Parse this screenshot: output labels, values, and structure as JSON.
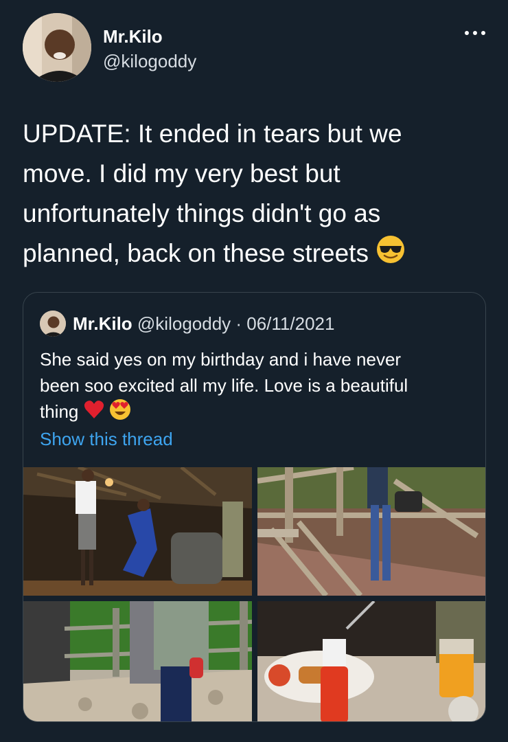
{
  "author": {
    "name": "Mr.Kilo",
    "handle": "@kilogoddy"
  },
  "tweet": {
    "lines": [
      "UPDATE: It ended in tears but we",
      "move. I did my very best but",
      "unfortunately things didn't go as",
      "planned, back on these streets"
    ],
    "emoji": "sunglasses-emoji"
  },
  "quoted": {
    "name": "Mr.Kilo",
    "handle_date": "@kilogoddy · 06/11/2021",
    "lines": [
      "She said yes on my birthday and i have never",
      "been soo excited all my life. Love is a beautiful",
      "thing"
    ],
    "emojis": [
      "red-heart-emoji",
      "heart-eyes-emoji"
    ],
    "show_thread": "Show this thread"
  },
  "photos": [
    "proposal-indoor-photo",
    "deck-walkway-photo",
    "stone-patio-photo",
    "breakfast-table-photo"
  ],
  "colors": {
    "background": "#15202b",
    "border": "#38444d",
    "link": "#3ea5f0",
    "secondary_text": "#d7dde3"
  }
}
